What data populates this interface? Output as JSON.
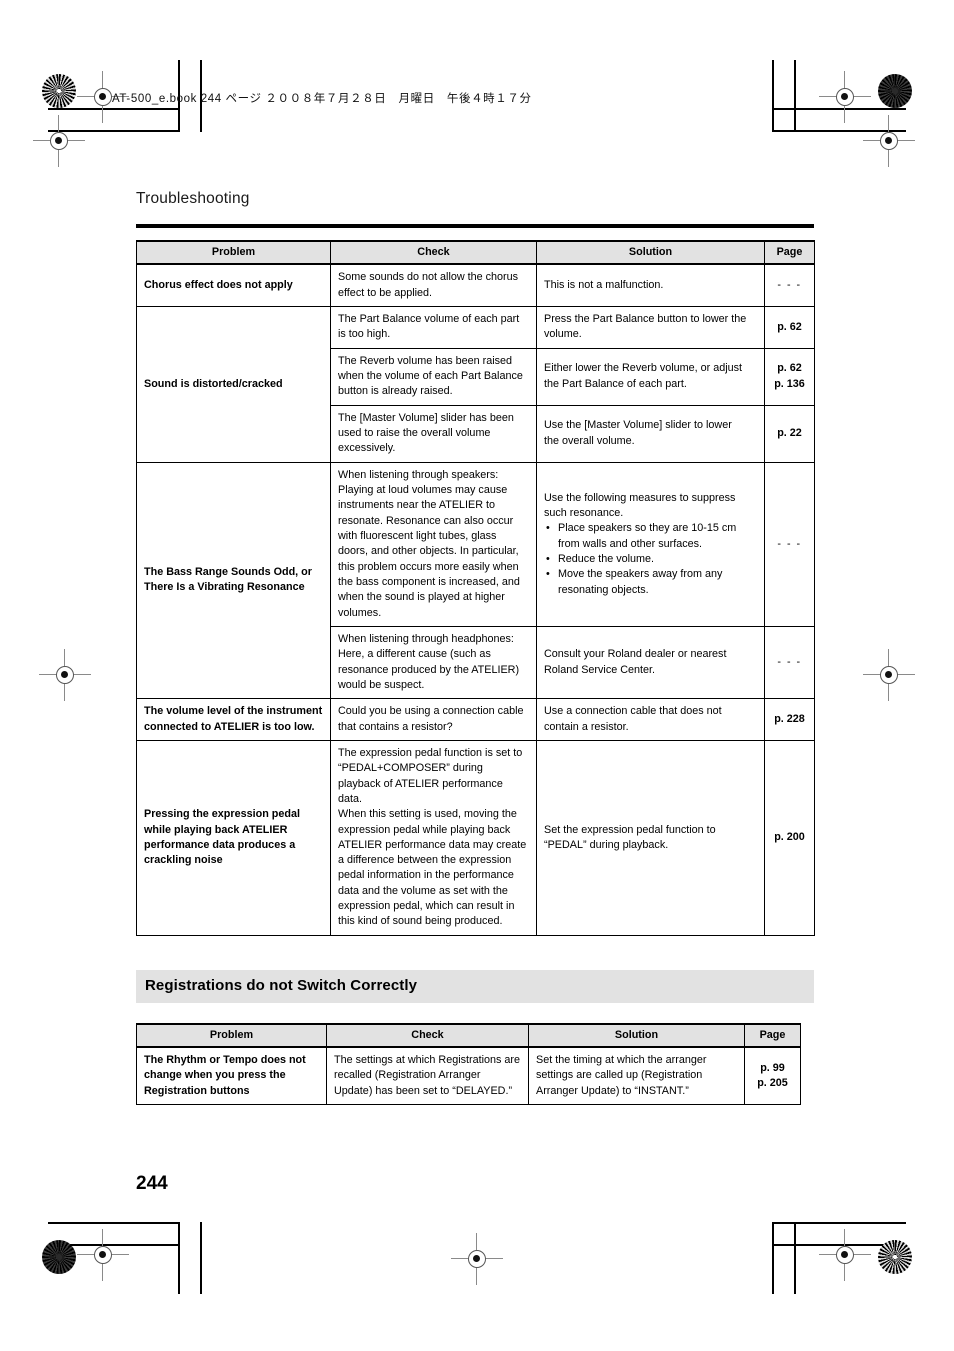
{
  "running_head": "AT-500_e.book  244 ページ  ２００８年７月２８日　月曜日　午後４時１７分",
  "chapter_title": "Troubleshooting",
  "folio": "244",
  "colors": {
    "header_fill": "#e2e2e2",
    "band_fill": "#e2e2e2",
    "rule": "#000000",
    "mark": "#8a8a8a"
  },
  "table_headers": {
    "problem": "Problem",
    "check": "Check",
    "solution": "Solution",
    "page": "Page"
  },
  "table1": {
    "rows": [
      {
        "problem": "Chorus effect does not apply",
        "check": [
          "Some sounds do not allow the chorus",
          "effect to be applied."
        ],
        "solution": [
          "This is not a malfunction."
        ],
        "page": "- - -"
      },
      {
        "problem": "Sound is distorted/cracked",
        "check": [
          "The Part Balance volume of each part",
          "is too high."
        ],
        "solution": [
          "Press the Part Balance button to lower the",
          "volume."
        ],
        "page": "p. 62"
      },
      {
        "problem": "",
        "check": [
          "The Reverb volume has been raised",
          "when the volume of each Part Balance",
          "button is already raised."
        ],
        "solution": [
          "Either lower the Reverb volume, or adjust",
          "the Part Balance of each part."
        ],
        "page": "p. 62\np. 136",
        "page_lines": [
          "p. 62",
          "p. 136"
        ]
      },
      {
        "problem": "",
        "check": [
          "The [Master Volume] slider has been",
          "used to raise the overall volume",
          "excessively."
        ],
        "solution": [
          "Use the [Master Volume] slider to lower",
          "the overall volume."
        ],
        "page": "p. 22"
      },
      {
        "problem": "The Bass Range Sounds Odd, or There Is a Vibrating Resonance",
        "problem_lines": [
          "The Bass Range Sounds Odd, or",
          "There Is a Vibrating Resonance"
        ],
        "check": [
          "When listening through speakers:",
          "Playing at loud volumes may cause",
          "instruments near the ATELIER to",
          "resonate. Resonance can also occur",
          "with fluorescent light tubes, glass",
          "doors, and other objects. In particular,",
          "this problem occurs more easily when",
          "the bass component is increased, and",
          "when the sound is played at higher",
          "volumes."
        ],
        "solution_intro": [
          "Use the following measures to suppress",
          "such resonance."
        ],
        "solution_bullets": [
          "Place speakers so they are 10-15 cm from walls and other surfaces.",
          "Reduce the volume.",
          "Move the speakers away from any resonating objects."
        ],
        "page": "- - -"
      },
      {
        "problem": "",
        "check": [
          "When listening through headphones:",
          "Here, a different cause (such as",
          "resonance produced by the ATELIER)",
          "would be suspect."
        ],
        "solution": [
          "Consult your Roland dealer or nearest",
          "Roland Service Center."
        ],
        "page": "- - -"
      },
      {
        "problem": "The volume level of the instrument connected to ATELIER is too low.",
        "problem_lines": [
          "The volume level of the instrument",
          "connected to ATELIER is too low."
        ],
        "check": [
          "Could you be using a connection cable",
          "that contains a resistor?"
        ],
        "solution": [
          "Use a connection cable that does not",
          "contain a resistor."
        ],
        "page": "p. 228"
      },
      {
        "problem": "Pressing the expression pedal while playing back ATELIER performance data produces a crackling noise",
        "problem_lines": [
          "Pressing the expression pedal",
          "while playing back ATELIER",
          "performance data produces a",
          "crackling noise"
        ],
        "check": [
          "The expression pedal function is set to",
          "“PEDAL+COMPOSER” during",
          "playback of ATELIER performance",
          "data.",
          "When this setting is used, moving the",
          "expression pedal while playing back",
          "ATELIER performance data may create",
          "a difference between the expression",
          "pedal information in the performance",
          "data and the volume as set with the",
          "expression pedal, which can result in",
          "this kind of sound being produced."
        ],
        "solution": [
          "Set the expression pedal function to",
          "“PEDAL” during playback."
        ],
        "page": "p. 200"
      }
    ]
  },
  "section2": {
    "title": "Registrations do not Switch Correctly",
    "rows": [
      {
        "problem": "The Rhythm or Tempo does not change when you press the Registration buttons",
        "problem_lines": [
          "The Rhythm or Tempo does not",
          "change when you press the",
          "Registration buttons"
        ],
        "check": [
          "The settings at which Registrations are",
          "recalled (Registration Arranger",
          "Update) has been set to “DELAYED.”"
        ],
        "solution": [
          "Set the timing at which the arranger",
          "settings are called up (Registration",
          "Arranger Update) to “INSTANT.”"
        ],
        "page_lines": [
          "p. 99",
          "p. 205"
        ]
      }
    ]
  }
}
